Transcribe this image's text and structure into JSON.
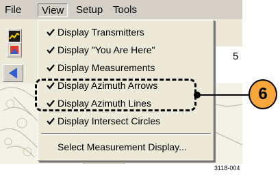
{
  "menubar": {
    "items": [
      {
        "label": "File"
      },
      {
        "label": "View"
      },
      {
        "label": "Setup"
      },
      {
        "label": "Tools"
      }
    ]
  },
  "background": {
    "partial_text": "5"
  },
  "view_menu": {
    "items": [
      {
        "label": "Display Transmitters",
        "checked": true
      },
      {
        "label": "Display \"You Are Here\"",
        "checked": true
      },
      {
        "label": "Display Measurements",
        "checked": true
      },
      {
        "label": "Display Azimuth Arrows",
        "checked": true
      },
      {
        "label": "Display Azimuth Lines",
        "checked": true
      },
      {
        "label": "Display Intersect Circles",
        "checked": true
      }
    ],
    "select_item": {
      "label": "Select Measurement Display..."
    }
  },
  "callout": {
    "number": "6",
    "color": "#f7a63c"
  },
  "figure_id": "3118-004",
  "icons": [
    "chart-icon",
    "map-icon",
    "left-arrow-icon",
    "check-icon"
  ]
}
